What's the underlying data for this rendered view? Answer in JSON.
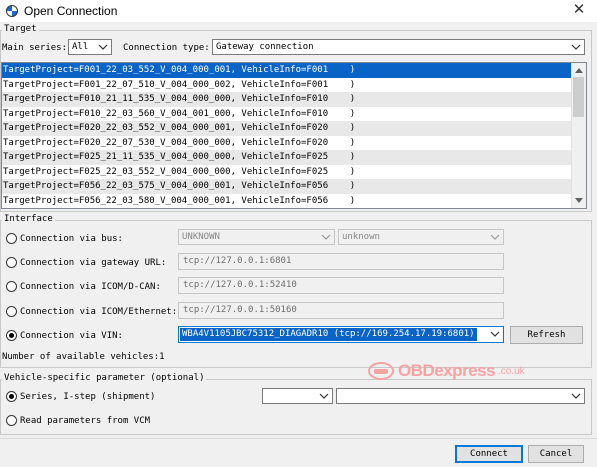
{
  "window": {
    "title": "Open Connection",
    "close_glyph": "✕"
  },
  "target": {
    "legend": "Target",
    "main_series_label": "Main series:",
    "main_series_value": "All",
    "connection_type_label": "Connection type:",
    "connection_type_value": "Gateway connection",
    "projects": [
      "TargetProject=F001_22_03_552_V_004_000_001, VehicleInfo=F001    )",
      "TargetProject=F001_22_07_510_V_004_000_002, VehicleInfo=F001    )",
      "TargetProject=F010_21_11_535_V_004_000_000, VehicleInfo=F010    )",
      "TargetProject=F010_22_03_560_V_004_001_000, VehicleInfo=F010    )",
      "TargetProject=F020_22_03_552_V_004_000_001, VehicleInfo=F020    )",
      "TargetProject=F020_22_07_530_V_004_000_000, VehicleInfo=F020    )",
      "TargetProject=F025_21_11_535_V_004_000_000, VehicleInfo=F025    )",
      "TargetProject=F025_22_03_552_V_004_000_000, VehicleInfo=F025    )",
      "TargetProject=F056_22_03_575_V_004_000_001, VehicleInfo=F056    )",
      "TargetProject=F056_22_03_580_V_004_000_001, VehicleInfo=F056    )"
    ],
    "selected_index": 0
  },
  "interface": {
    "legend": "Interface",
    "bus_label": "Connection via bus:",
    "bus_value_1": "UNKNOWN",
    "bus_value_2": "unknown",
    "gateway_label": "Connection via gateway URL:",
    "gateway_value": "tcp://127.0.0.1:6801",
    "icom_dcan_label": "Connection via ICOM/D-CAN:",
    "icom_dcan_value": "tcp://127.0.0.1:52410",
    "icom_eth_label": "Connection via ICOM/Ethernet:",
    "icom_eth_value": "tcp://127.0.0.1:50160",
    "vin_label": "Connection via VIN:",
    "vin_value": "WBA4V1105JBC75312_DIAGADR10 (tcp://169.254.17.19:6801)",
    "refresh_label": "Refresh",
    "vehicles_text": "Number of available vehicles:1",
    "selected": "vin"
  },
  "vehicle_params": {
    "legend": "Vehicle-specific parameter (optional)",
    "series_label": "Series, I-step (shipment)",
    "series_value": "",
    "istep_value": "",
    "vcm_label": "Read parameters from VCM",
    "selected": "series"
  },
  "footer": {
    "connect_label": "Connect",
    "cancel_label": "Cancel"
  },
  "watermark": {
    "brand": "OBDexpress",
    "suffix": ".co.uk"
  },
  "colors": {
    "selection": "#0a64c8",
    "accent": "#0078d7",
    "watermark": "#f5a3a3"
  }
}
